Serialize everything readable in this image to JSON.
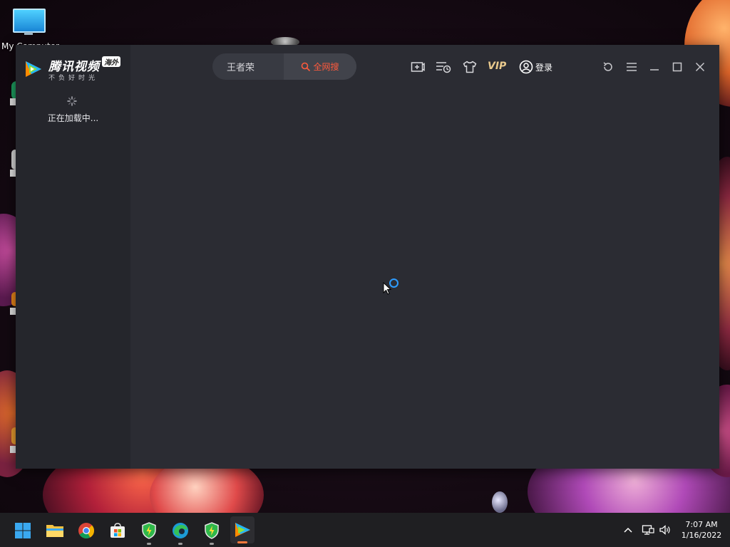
{
  "desktop": {
    "icons": [
      {
        "label": "My Computer",
        "icon": "monitor-icon"
      }
    ]
  },
  "window": {
    "logo": {
      "title": "腾讯视频",
      "badge": "海外",
      "slogan": "不负好时光"
    },
    "search": {
      "value": "王者荣",
      "button_label": "全网搜",
      "button_color": "#ff5a3c"
    },
    "toolbar": {
      "vip_label": "VIP",
      "login_label": "登录",
      "icons": [
        "add-video-icon",
        "playlist-history-icon",
        "skin-shirt-icon",
        "refresh-icon",
        "menu-icon",
        "minimize-icon",
        "maximize-icon",
        "close-icon"
      ]
    },
    "sidebar": {
      "loading_text": "正在加载中..."
    }
  },
  "taskbar": {
    "apps": [
      "start-icon",
      "file-explorer-icon",
      "chrome-icon",
      "store-icon",
      "security-shield-icon",
      "edge-icon",
      "security-shield-icon",
      "tencent-video-icon"
    ],
    "clock": {
      "time": "7:07 AM",
      "date": "1/16/2022"
    }
  },
  "colors": {
    "window_bg": "#2b2c33",
    "sidebar_bg": "#25262c",
    "accent": "#ff5a3c",
    "vip": "#e9c98d",
    "busy_cursor": "#2d9cff"
  }
}
